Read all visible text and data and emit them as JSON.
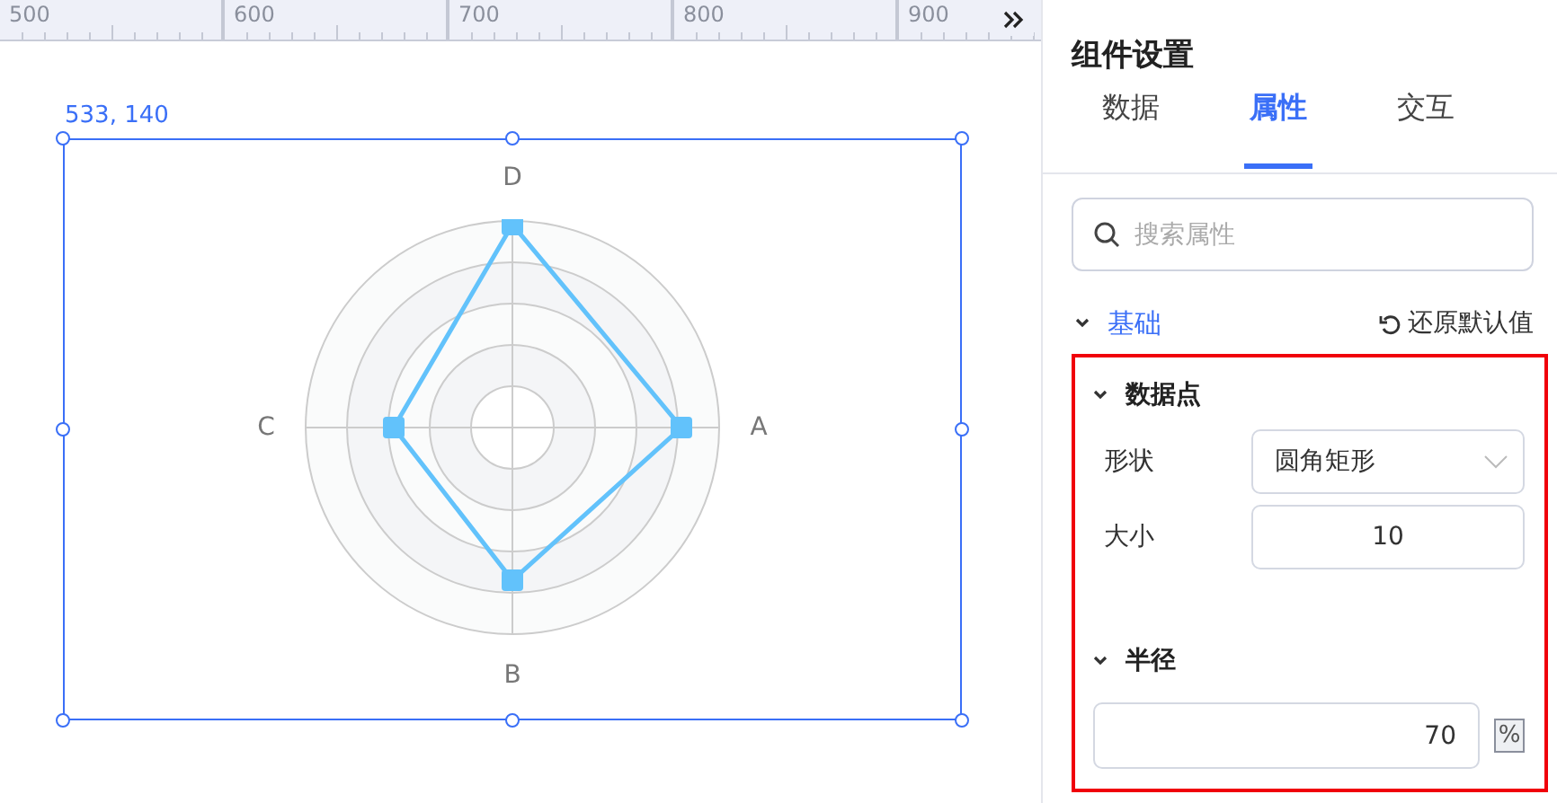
{
  "ruler": {
    "labels": [
      "500",
      "600",
      "700",
      "800",
      "900"
    ]
  },
  "canvas": {
    "position": "533, 140",
    "chart": {
      "axis_labels": [
        "A",
        "B",
        "C",
        "D"
      ]
    }
  },
  "panel": {
    "title": "组件设置",
    "tabs": [
      {
        "label": "数据",
        "selected": false
      },
      {
        "label": "属性",
        "selected": true
      },
      {
        "label": "交互",
        "selected": false
      }
    ],
    "search": {
      "placeholder": "搜索属性"
    },
    "section": {
      "title": "基础",
      "expanded": true,
      "reset": "还原默认值"
    },
    "groups": [
      {
        "title": "数据点",
        "expanded": true,
        "fields": [
          {
            "label": "形状",
            "kind": "select",
            "value": "圆角矩形"
          },
          {
            "label": "大小",
            "kind": "number",
            "value": "10"
          }
        ]
      },
      {
        "title": "半径",
        "expanded": true,
        "fields": [
          {
            "kind": "percent",
            "value": "70",
            "unit": "%"
          }
        ]
      }
    ]
  }
}
